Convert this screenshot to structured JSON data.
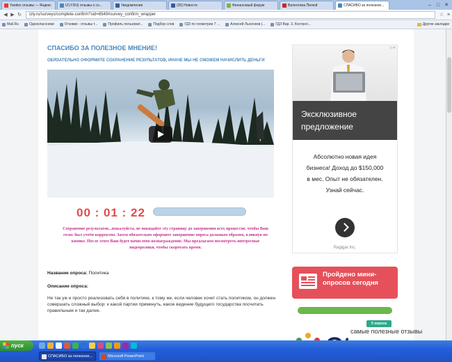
{
  "browser": {
    "tabs": [
      {
        "label": "Yandex отзывы — Яндекс",
        "color": "#e53935"
      },
      {
        "label": "IZLY.RU| отзывы о со...",
        "color": "#4a86b8"
      },
      {
        "label": "Уведомления",
        "color": "#3b5998"
      },
      {
        "label": "(35) Новости",
        "color": "#3b5998"
      },
      {
        "label": "Финансовый форум",
        "color": "#7cb342"
      },
      {
        "label": "Валентина Пилюй",
        "color": "#c62828"
      },
      {
        "label": "СПАСИБО за полезное...",
        "color": "#4a86b8",
        "active": true
      }
    ],
    "url": "izly.ru/surveys/complete-confirm?sid=6549#survey_confirm_wrapper",
    "bookmarks": [
      "Mail.Ru",
      "Одноклассники",
      "Отзовик - отзывы т...",
      "Профиль пользоват...",
      "Подбор слов",
      "ГДЗ по геометрии 7 ...",
      "Алексей Лысенков |...",
      "ГДЗ Вар. 3, Контрол..."
    ],
    "other_bookmarks": "Другие закладки"
  },
  "page": {
    "title": "СПАСИБО ЗА ПОЛЕЗНОЕ МНЕНИЕ!",
    "subtitle": "ОБЯЗАТЕЛЬНО ОФОРМИТЕ СОХРАНЕНИЕ РЕЗУЛЬТАТОВ, ИНАЧЕ МЫ НЕ СМОЖЕМ НАЧИСЛИТЬ ДЕНЬГИ",
    "timer": "00 : 01 : 22",
    "timer_progress": 0.0,
    "notice": "Сохранение результатов...пожалуйста, не покидайте эту страницу до завершения всех процессов, чтобы Ваш голос был учтён корректно. Затем обязательно оформите завершение опроса должным образом, кликнув по кнопке. После этого Ваш будет начислено вознаграждение. Мы предлагаем посмотреть интересные видеоролики, чтобы скоротать время.",
    "survey_name_label": "Название опроса:",
    "survey_name_value": "Политика",
    "survey_desc_label": "Описание опроса:",
    "survey_desc_text": "Не так уж и просто реализовать себя в политике, к тому же, если человек хочет стать политиком, он должен совершать сложный выбор: к какой партии примкнуть, какое видение будущего государства посчитать правильным и так далее."
  },
  "ad": {
    "headline_1": "Эксклюзивное",
    "headline_2": "предложение",
    "body": [
      "Абсолютно новая идея",
      "бизнеса! Доход до $150,000",
      "в мес. Опыт не обязателен.",
      "Узнай сейчас."
    ],
    "sponsor": "Ragigar Inc."
  },
  "widget": {
    "title_1": "Пройдено мини-",
    "title_2": "опросов сегодня",
    "progress": 1.0,
    "badge": "5 опроса"
  },
  "watermark": {
    "tagline": "самые полезные отзывы",
    "logo": "Otzyv.pro"
  },
  "taskbar": {
    "start": "пуск",
    "tasks": [
      "СПАСИБО за полезное...",
      "Microsoft PowerPoint"
    ]
  }
}
